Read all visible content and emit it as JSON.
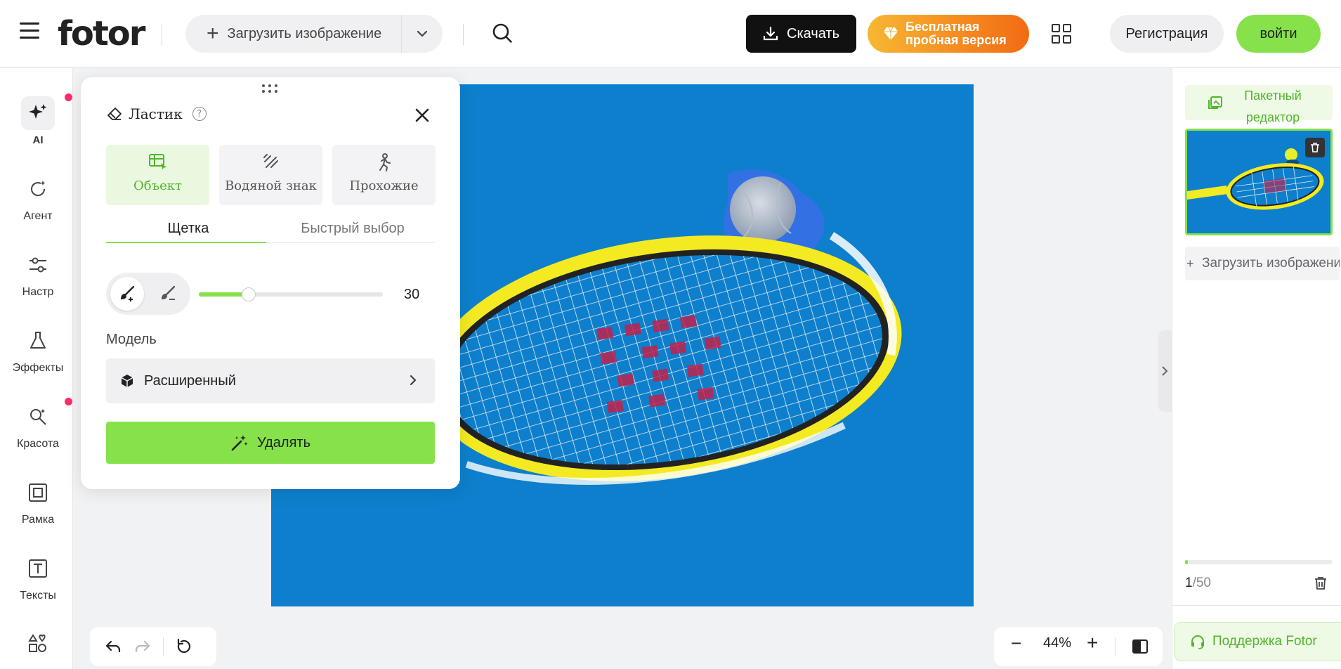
{
  "header": {
    "logo": "fotor",
    "upload_label": "Загрузить изображение",
    "download_label": "Скачать",
    "trial_line1": "Бесплатная",
    "trial_line2": "пробная версия",
    "register_label": "Регистрация",
    "login_label": "войти"
  },
  "sidebar": {
    "items": [
      {
        "label": "AI",
        "icon": "sparkle-icon"
      },
      {
        "label": "Агент",
        "icon": "agent-icon"
      },
      {
        "label": "Настр",
        "icon": "sliders-icon"
      },
      {
        "label": "Эффекты",
        "icon": "flask-icon"
      },
      {
        "label": "Красота",
        "icon": "beauty-icon"
      },
      {
        "label": "Рамка",
        "icon": "frame-icon"
      },
      {
        "label": "Тексты",
        "icon": "text-icon"
      }
    ]
  },
  "eraser_panel": {
    "title": "Ластик",
    "help": "?",
    "modes": [
      {
        "label": "Объект",
        "icon": "object-icon"
      },
      {
        "label": "Водяной знак",
        "icon": "watermark-icon"
      },
      {
        "label": "Прохожие",
        "icon": "passerby-icon"
      }
    ],
    "tabs": [
      "Щетка",
      "Быстрый выбор"
    ],
    "brush_size": 30,
    "brush_size_fraction": 0.27,
    "model_label": "Модель",
    "model_value": "Расширенный",
    "remove_label": "Удалять"
  },
  "zoom": {
    "value": "44%",
    "minus": "−",
    "plus": "+"
  },
  "right_panel": {
    "batch_line1": "Пакетный",
    "batch_line2": "редактор",
    "upload_label": "Загрузить изображение",
    "count_current": "1",
    "count_total": "/50",
    "progress_fraction": 0.02,
    "support_label": "Поддержка Fotor"
  },
  "colors": {
    "accent": "#86e14a",
    "accent_text": "#52b52a",
    "court_blue": "#0d7fcc",
    "dot_red": "#ff2d67"
  }
}
